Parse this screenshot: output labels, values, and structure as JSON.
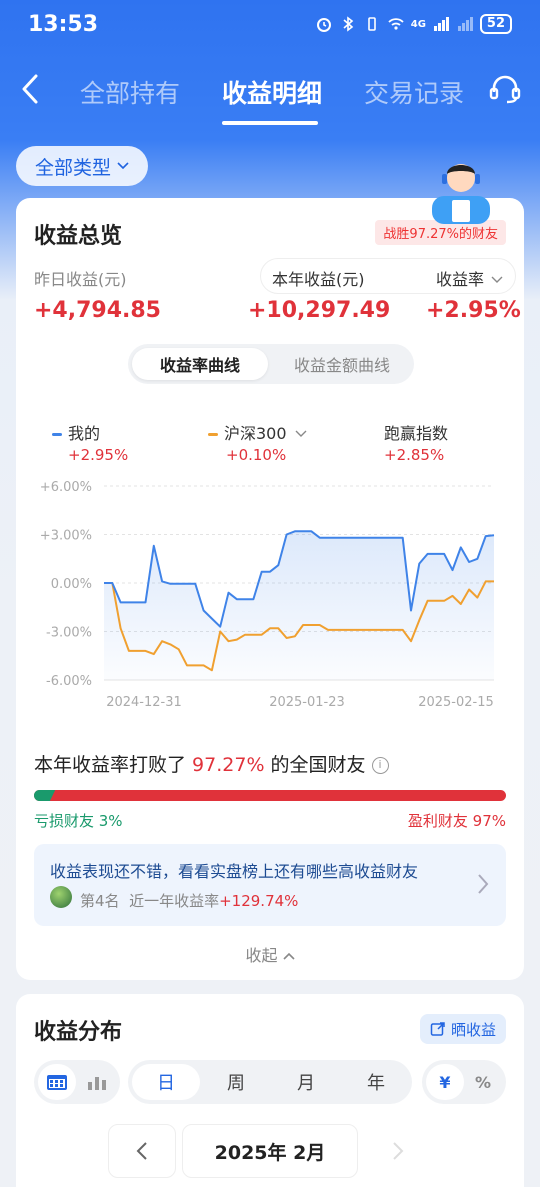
{
  "status_bar": {
    "time": "13:53",
    "network": "4G",
    "battery": "52"
  },
  "nav": {
    "tabs": [
      {
        "label": "全部持有",
        "active": false
      },
      {
        "label": "收益明细",
        "active": true
      },
      {
        "label": "交易记录",
        "active": false
      }
    ]
  },
  "filter": {
    "type_label": "全部类型"
  },
  "overview": {
    "title": "收益总览",
    "beat_badge": "战胜97.27%的财友",
    "yesterday_label": "昨日收益(元)",
    "yesterday_value": "+4,794.85",
    "year_label": "本年收益(元)",
    "year_value": "+10,297.49",
    "rate_label": "收益率",
    "rate_value": "+2.95%",
    "toggle": {
      "active": "收益率曲线",
      "inactive": "收益金额曲线"
    },
    "legend": [
      {
        "name": "我的",
        "value": "+2.95%",
        "color": "#3f83e8"
      },
      {
        "name": "沪深300",
        "value": "+0.10%",
        "color": "#f0a030"
      },
      {
        "name": "跑赢指数",
        "value": "+2.85%"
      }
    ]
  },
  "chart_data": {
    "type": "line",
    "x_ticks": [
      "2024-12-31",
      "2025-01-23",
      "2025-02-15"
    ],
    "y_ticks": [
      "+6.00%",
      "+3.00%",
      "0.00%",
      "-3.00%",
      "-6.00%"
    ],
    "ylim": [
      -6,
      6
    ],
    "series": [
      {
        "name": "我的",
        "color": "#3f83e8",
        "values": [
          0,
          0,
          -1.2,
          -1.2,
          -1.2,
          -1.2,
          2.3,
          0.1,
          -0.05,
          -0.05,
          -0.05,
          -0.05,
          -1.7,
          -2.2,
          -2.7,
          -0.6,
          -1.0,
          -1.0,
          -1.0,
          0.7,
          0.7,
          1.1,
          3.0,
          3.2,
          3.2,
          3.2,
          2.8,
          2.8,
          2.8,
          2.8,
          2.8,
          2.8,
          2.8,
          2.8,
          2.8,
          2.8,
          2.8,
          -1.7,
          1.2,
          1.8,
          1.8,
          1.8,
          0.8,
          2.2,
          1.3,
          1.5,
          2.9,
          2.95
        ]
      },
      {
        "name": "沪深300",
        "color": "#f0a030",
        "values": [
          0,
          0,
          -2.8,
          -4.2,
          -4.2,
          -4.2,
          -4.4,
          -3.6,
          -3.8,
          -4.1,
          -5.1,
          -5.1,
          -5.1,
          -5.4,
          -3.0,
          -3.6,
          -3.5,
          -3.2,
          -3.2,
          -3.2,
          -2.8,
          -2.8,
          -3.4,
          -3.3,
          -2.6,
          -2.6,
          -2.6,
          -2.9,
          -2.9,
          -2.9,
          -2.9,
          -2.9,
          -2.9,
          -2.9,
          -2.9,
          -2.9,
          -2.9,
          -3.6,
          -2.3,
          -1.1,
          -1.1,
          -1.1,
          -0.8,
          -1.3,
          -0.4,
          -0.9,
          0.1,
          0.1
        ]
      }
    ]
  },
  "beat": {
    "prefix": "本年收益率打败了 ",
    "percent": "97.27%",
    "suffix": " 的全国财友",
    "loss_label": "亏损财友 3%",
    "profit_label": "盈利财友 97%",
    "loss_fraction": 0.03
  },
  "promo": {
    "title": "收益表现还不错，看看实盘榜上还有哪些高收益财友",
    "rank": "第4名",
    "desc": "近一年收益率",
    "value": "+129.74%"
  },
  "collapse_label": "收起",
  "distribution": {
    "title": "收益分布",
    "share_label": "晒收益",
    "periods": [
      "日",
      "周",
      "月",
      "年"
    ],
    "active_period": "日",
    "unit_active": "¥",
    "unit_inactive": "%",
    "month_label": "2025年 2月"
  },
  "colors": {
    "red": "#e0323a",
    "green": "#1a9a6c",
    "blue": "#2366e1"
  }
}
